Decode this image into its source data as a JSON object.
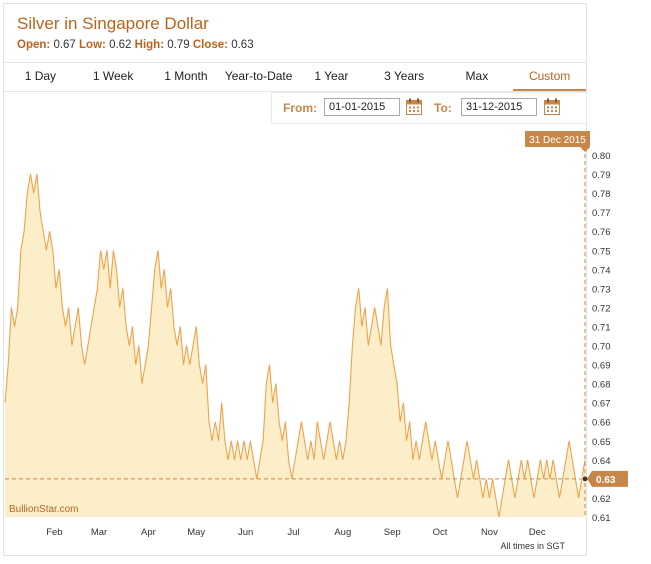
{
  "header": {
    "title": "Silver in Singapore Dollar",
    "ohlc": {
      "open_label": "Open:",
      "open": "0.67",
      "low_label": "Low:",
      "low": "0.62",
      "high_label": "High:",
      "high": "0.79",
      "close_label": "Close:",
      "close": "0.63"
    }
  },
  "tabs": [
    {
      "label": "1 Day"
    },
    {
      "label": "1 Week"
    },
    {
      "label": "1 Month"
    },
    {
      "label": "Year-to-Date"
    },
    {
      "label": "1 Year"
    },
    {
      "label": "3 Years"
    },
    {
      "label": "Max"
    },
    {
      "label": "Custom",
      "active": true
    }
  ],
  "range": {
    "from_label": "From:",
    "from": "01-01-2015",
    "to_label": "To:",
    "to": "31-12-2015"
  },
  "colors": {
    "accent": "#c8874a",
    "line": "#f0a24a",
    "fill": "#fbeec9",
    "title": "#b8641e"
  },
  "chart_data": {
    "type": "area",
    "ylim": [
      0.61,
      0.8
    ],
    "y_ticks": [
      "0.80",
      "0.79",
      "0.78",
      "0.77",
      "0.76",
      "0.75",
      "0.74",
      "0.73",
      "0.72",
      "0.71",
      "0.70",
      "0.69",
      "0.68",
      "0.67",
      "0.66",
      "0.65",
      "0.64",
      "0.63",
      "0.62",
      "0.61"
    ],
    "x_ticks": [
      "Feb",
      "Mar",
      "Apr",
      "May",
      "Jun",
      "Jul",
      "Aug",
      "Sep",
      "Oct",
      "Nov",
      "Dec"
    ],
    "x": [
      "01-01",
      "03-01",
      "05-01",
      "07-01",
      "09-01",
      "11-01",
      "13-01",
      "15-01",
      "17-01",
      "19-01",
      "21-01",
      "23-01",
      "25-01",
      "27-01",
      "29-01",
      "31-01",
      "02-02",
      "04-02",
      "06-02",
      "08-02",
      "10-02",
      "12-02",
      "14-02",
      "16-02",
      "18-02",
      "20-02",
      "22-02",
      "24-02",
      "26-02",
      "28-02",
      "02-03",
      "04-03",
      "06-03",
      "08-03",
      "10-03",
      "12-03",
      "14-03",
      "16-03",
      "18-03",
      "20-03",
      "22-03",
      "24-03",
      "26-03",
      "28-03",
      "30-03",
      "01-04",
      "03-04",
      "05-04",
      "07-04",
      "09-04",
      "11-04",
      "13-04",
      "15-04",
      "17-04",
      "19-04",
      "21-04",
      "23-04",
      "25-04",
      "27-04",
      "29-04",
      "01-05",
      "03-05",
      "05-05",
      "07-05",
      "09-05",
      "11-05",
      "13-05",
      "15-05",
      "17-05",
      "19-05",
      "21-05",
      "23-05",
      "25-05",
      "27-05",
      "29-05",
      "31-05",
      "02-06",
      "04-06",
      "06-06",
      "08-06",
      "10-06",
      "12-06",
      "14-06",
      "16-06",
      "18-06",
      "20-06",
      "22-06",
      "24-06",
      "26-06",
      "28-06",
      "30-06",
      "02-07",
      "04-07",
      "06-07",
      "08-07",
      "10-07",
      "12-07",
      "14-07",
      "16-07",
      "18-07",
      "20-07",
      "22-07",
      "24-07",
      "26-07",
      "28-07",
      "30-07",
      "01-08",
      "03-08",
      "05-08",
      "07-08",
      "09-08",
      "11-08",
      "13-08",
      "15-08",
      "17-08",
      "19-08",
      "21-08",
      "23-08",
      "25-08",
      "27-08",
      "29-08",
      "31-08",
      "02-09",
      "04-09",
      "06-09",
      "08-09",
      "10-09",
      "12-09",
      "14-09",
      "16-09",
      "18-09",
      "20-09",
      "22-09",
      "24-09",
      "26-09",
      "28-09",
      "30-09",
      "02-10",
      "04-10",
      "06-10",
      "08-10",
      "10-10",
      "12-10",
      "14-10",
      "16-10",
      "18-10",
      "20-10",
      "22-10",
      "24-10",
      "26-10",
      "28-10",
      "30-10",
      "01-11",
      "03-11",
      "05-11",
      "07-11",
      "09-11",
      "11-11",
      "13-11",
      "15-11",
      "17-11",
      "19-11",
      "21-11",
      "23-11",
      "25-11",
      "27-11",
      "29-11",
      "01-12",
      "03-12",
      "05-12",
      "07-12",
      "09-12",
      "11-12",
      "13-12",
      "15-12",
      "17-12",
      "19-12",
      "21-12",
      "23-12",
      "25-12",
      "27-12",
      "29-12",
      "31-12"
    ],
    "series": [
      {
        "values": [
          0.67,
          0.69,
          0.72,
          0.71,
          0.72,
          0.75,
          0.76,
          0.78,
          0.79,
          0.78,
          0.79,
          0.77,
          0.76,
          0.75,
          0.76,
          0.75,
          0.73,
          0.74,
          0.72,
          0.71,
          0.72,
          0.7,
          0.71,
          0.72,
          0.7,
          0.69,
          0.7,
          0.71,
          0.72,
          0.73,
          0.75,
          0.74,
          0.75,
          0.73,
          0.75,
          0.74,
          0.72,
          0.73,
          0.71,
          0.7,
          0.71,
          0.69,
          0.7,
          0.68,
          0.69,
          0.7,
          0.72,
          0.74,
          0.75,
          0.73,
          0.74,
          0.72,
          0.73,
          0.71,
          0.7,
          0.71,
          0.69,
          0.7,
          0.69,
          0.7,
          0.71,
          0.69,
          0.68,
          0.69,
          0.66,
          0.65,
          0.66,
          0.65,
          0.67,
          0.65,
          0.64,
          0.65,
          0.64,
          0.65,
          0.64,
          0.65,
          0.64,
          0.65,
          0.64,
          0.63,
          0.64,
          0.65,
          0.68,
          0.69,
          0.67,
          0.68,
          0.66,
          0.65,
          0.66,
          0.64,
          0.63,
          0.64,
          0.65,
          0.66,
          0.65,
          0.64,
          0.65,
          0.64,
          0.66,
          0.65,
          0.64,
          0.65,
          0.66,
          0.65,
          0.64,
          0.65,
          0.64,
          0.65,
          0.67,
          0.7,
          0.72,
          0.73,
          0.71,
          0.72,
          0.7,
          0.71,
          0.72,
          0.71,
          0.7,
          0.72,
          0.73,
          0.7,
          0.69,
          0.68,
          0.66,
          0.67,
          0.65,
          0.66,
          0.64,
          0.65,
          0.64,
          0.65,
          0.66,
          0.65,
          0.64,
          0.65,
          0.64,
          0.63,
          0.64,
          0.65,
          0.64,
          0.63,
          0.62,
          0.63,
          0.64,
          0.65,
          0.64,
          0.63,
          0.64,
          0.63,
          0.62,
          0.63,
          0.62,
          0.63,
          0.62,
          0.61,
          0.62,
          0.63,
          0.64,
          0.63,
          0.62,
          0.63,
          0.64,
          0.63,
          0.64,
          0.63,
          0.62,
          0.63,
          0.64,
          0.63,
          0.64,
          0.63,
          0.64,
          0.63,
          0.62,
          0.63,
          0.64,
          0.65,
          0.64,
          0.63,
          0.62,
          0.63,
          0.64,
          0.63,
          0.64,
          0.63
        ]
      }
    ],
    "crosshair": {
      "date_label": "31 Dec 2015",
      "value_label": "0.63"
    },
    "credit": "BullionStar.com",
    "footnote": "All times in SGT"
  }
}
